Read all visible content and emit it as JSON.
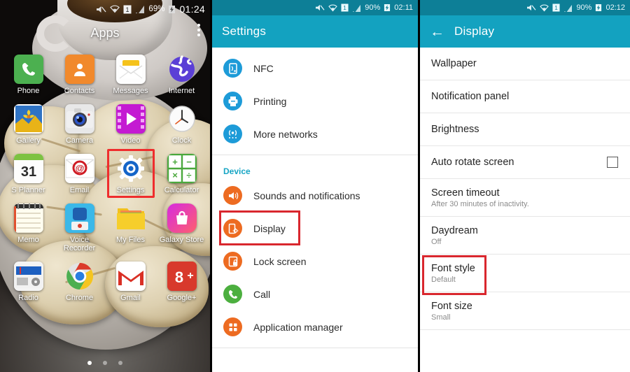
{
  "home": {
    "statusbar": {
      "icons": [
        "mute-icon",
        "wifi-icon",
        "sim-1-icon",
        "signal-bars-icon"
      ],
      "battery_pct": "69%",
      "battery_icon": "battery-charging-icon",
      "time": "01:24"
    },
    "title": "Apps",
    "overflow_menu": "overflow-menu-icon",
    "apps": [
      {
        "label": "Phone",
        "icon": "phone-icon"
      },
      {
        "label": "Contacts",
        "icon": "contacts-icon"
      },
      {
        "label": "Messages",
        "icon": "messages-icon"
      },
      {
        "label": "Internet",
        "icon": "internet-globe-icon"
      },
      {
        "label": "Gallery",
        "icon": "gallery-icon"
      },
      {
        "label": "Camera",
        "icon": "camera-icon"
      },
      {
        "label": "Video",
        "icon": "video-icon"
      },
      {
        "label": "Clock",
        "icon": "clock-icon"
      },
      {
        "label": "S Planner",
        "icon": "calendar-icon"
      },
      {
        "label": "Email",
        "icon": "email-icon"
      },
      {
        "label": "Settings",
        "icon": "settings-gear-icon"
      },
      {
        "label": "Calculator",
        "icon": "calculator-icon"
      },
      {
        "label": "Memo",
        "icon": "memo-icon"
      },
      {
        "label": "Voice Recorder",
        "icon": "voice-recorder-icon"
      },
      {
        "label": "My Files",
        "icon": "folder-icon"
      },
      {
        "label": "Galaxy Store",
        "icon": "galaxy-store-icon"
      },
      {
        "label": "Radio",
        "icon": "radio-icon"
      },
      {
        "label": "Chrome",
        "icon": "chrome-icon"
      },
      {
        "label": "Gmail",
        "icon": "gmail-icon"
      },
      {
        "label": "Google+",
        "icon": "google-plus-icon"
      }
    ],
    "selected_app": "Settings",
    "page_dots": {
      "count": 3,
      "active": 1
    }
  },
  "settings": {
    "statusbar": {
      "battery_pct": "90%",
      "time": "02:11"
    },
    "title": "Settings",
    "items_top": [
      {
        "label": "NFC",
        "icon": "nfc-icon",
        "color": "blue"
      },
      {
        "label": "Printing",
        "icon": "printer-icon",
        "color": "blue"
      },
      {
        "label": "More networks",
        "icon": "more-networks-icon",
        "color": "blue"
      }
    ],
    "section_device": "Device",
    "items_device": [
      {
        "label": "Sounds and notifications",
        "icon": "speaker-icon",
        "color": "orange"
      },
      {
        "label": "Display",
        "icon": "display-icon",
        "color": "orange"
      },
      {
        "label": "Lock screen",
        "icon": "lock-screen-icon",
        "color": "orange"
      },
      {
        "label": "Call",
        "icon": "call-icon",
        "color": "green"
      },
      {
        "label": "Application manager",
        "icon": "app-manager-icon",
        "color": "orange"
      }
    ],
    "selected_item": "Display",
    "highlight_color": "#d9272e"
  },
  "display": {
    "statusbar": {
      "battery_pct": "90%",
      "time": "02:12"
    },
    "back": "back-arrow-icon",
    "title": "Display",
    "items": [
      {
        "label": "Wallpaper",
        "sub": ""
      },
      {
        "label": "Notification panel",
        "sub": ""
      },
      {
        "label": "Brightness",
        "sub": ""
      },
      {
        "label": "Auto rotate screen",
        "sub": "",
        "checkbox": "unchecked"
      },
      {
        "label": "Screen timeout",
        "sub": "After 30 minutes of inactivity."
      },
      {
        "label": "Daydream",
        "sub": "Off"
      },
      {
        "label": "Font style",
        "sub": "Default"
      },
      {
        "label": "Font size",
        "sub": "Small"
      }
    ],
    "selected_item": "Font style",
    "highlight_color": "#d9272e"
  }
}
